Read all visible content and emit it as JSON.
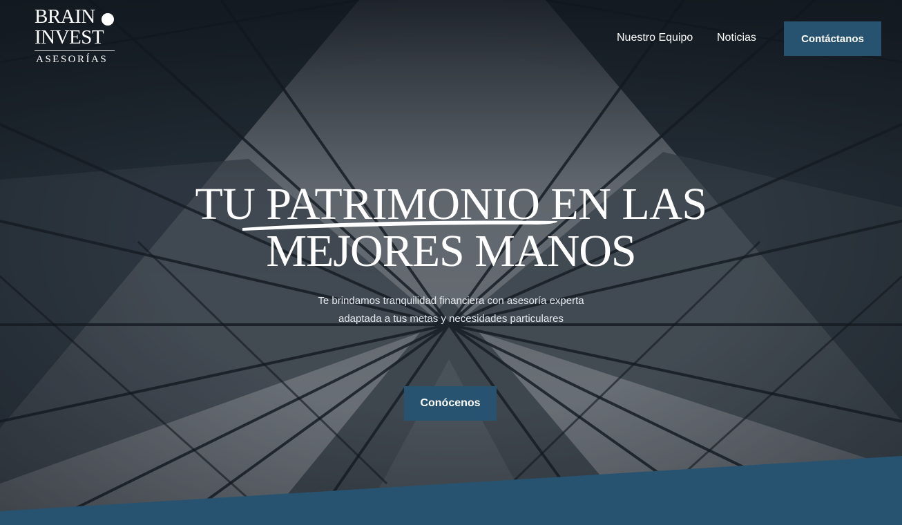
{
  "logo": {
    "line1": "BRAIN",
    "line2": "INVEST",
    "line3": "ASESORÍAS"
  },
  "nav": {
    "items": [
      {
        "label": "Nuestro Equipo"
      },
      {
        "label": "Noticias"
      }
    ],
    "cta_label": "Contáctanos"
  },
  "hero": {
    "headline_line1": "TU PATRIMONIO EN LAS",
    "headline_line2": "MEJORES MANOS",
    "subtitle_line1": "Te brindamos tranquilidad financiera con asesoría experta",
    "subtitle_line2": "adaptada a tus metas y necesidades particulares",
    "button_label": "Conócenos"
  },
  "colors": {
    "accent": "#275370",
    "overlay": "#1c2229",
    "text": "#ffffff"
  }
}
